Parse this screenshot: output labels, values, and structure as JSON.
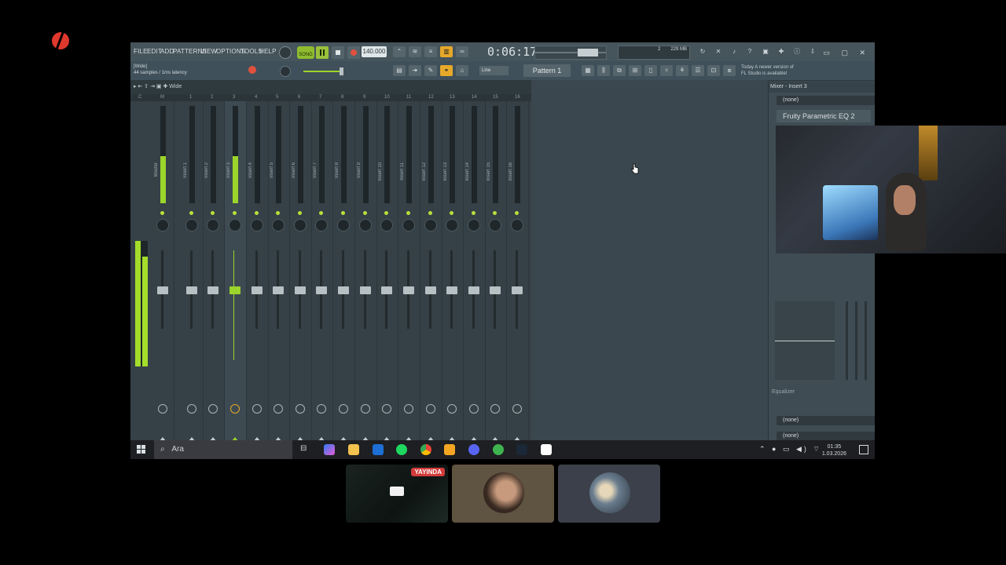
{
  "fl": {
    "menu": [
      "FILE",
      "EDIT",
      "ADD",
      "PATTERNS",
      "VIEW",
      "OPTIONS",
      "TOOLS",
      "HELP"
    ],
    "song_mode": "SONG",
    "tempo": "140.000",
    "time": "0:06:17",
    "cpu_mem": "229 MB",
    "cpu_num": "2",
    "hint_line1": "[Wide]",
    "hint_line2": "44 samples / 1ms latency",
    "snap": "Line",
    "pattern": "Pattern 1",
    "news_line1": "Today   A newer version of",
    "news_line2": "FL Studio is available!"
  },
  "mixer": {
    "toolbar_label": "Wide",
    "tracks": [
      {
        "label": "Master",
        "level": 0.48,
        "active": false
      },
      {
        "label": "Insert 1",
        "level": 0,
        "active": false
      },
      {
        "label": "Insert 2",
        "level": 0,
        "active": false
      },
      {
        "label": "Insert 3",
        "level": 0.48,
        "active": true
      },
      {
        "label": "Insert 4",
        "level": 0,
        "active": false
      },
      {
        "label": "Insert 5",
        "level": 0,
        "active": false
      },
      {
        "label": "Insert 6",
        "level": 0,
        "active": false
      },
      {
        "label": "Insert 7",
        "level": 0,
        "active": false
      },
      {
        "label": "Insert 8",
        "level": 0,
        "active": false
      },
      {
        "label": "Insert 9",
        "level": 0,
        "active": false
      },
      {
        "label": "Insert 10",
        "level": 0,
        "active": false
      },
      {
        "label": "Insert 11",
        "level": 0,
        "active": false
      },
      {
        "label": "Insert 12",
        "level": 0,
        "active": false
      },
      {
        "label": "Insert 13",
        "level": 0,
        "active": false
      },
      {
        "label": "Insert 14",
        "level": 0,
        "active": false
      },
      {
        "label": "Insert 15",
        "level": 0,
        "active": false
      },
      {
        "label": "Insert 16",
        "level": 0,
        "active": false
      }
    ],
    "numbers": [
      "C",
      "M",
      "1",
      "2",
      "3",
      "4",
      "5",
      "6",
      "7",
      "8",
      "9",
      "10",
      "11",
      "12",
      "13",
      "14",
      "15",
      "16"
    ]
  },
  "fxpanel": {
    "title": "Mixer - Insert 3",
    "slot_top": "(none)",
    "plugin": "Fruity Parametric EQ 2",
    "eq_label": "Equalizer",
    "slot_bottom1": "(none)",
    "slot_bottom2": "(none)"
  },
  "taskbar": {
    "search_placeholder": "Ara",
    "time": "01:35",
    "date": "1.03.2026"
  },
  "participants": {
    "live_badge": "YAYINDA"
  },
  "colors": {
    "accent_green": "#9bd42a",
    "live_red": "#d23b3b",
    "fl_panel": "#3b474e"
  }
}
